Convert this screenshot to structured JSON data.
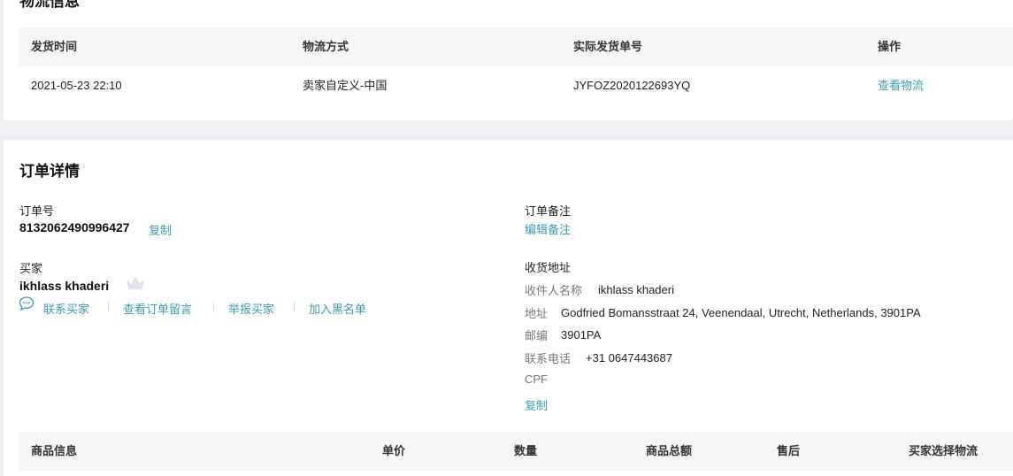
{
  "logistics": {
    "title": "物流信息",
    "headers": [
      "发货时间",
      "物流方式",
      "实际发货单号",
      "操作"
    ],
    "row": {
      "ship_time": "2021-05-23 22:10",
      "method": "卖家自定义-中国",
      "tracking_no": "JYFOZ2020122693YQ",
      "action": "查看物流"
    }
  },
  "order": {
    "title": "订单详情",
    "order_no_label": "订单号",
    "order_no": "8132062490996427",
    "copy_label": "复制",
    "remark_label": "订单备注",
    "edit_remark": "编辑备注",
    "buyer_label": "买家",
    "buyer_name": "ikhlass khaderi",
    "buyer_actions": [
      "联系买家",
      "查看订单留言",
      "举报买家",
      "加入黑名单"
    ],
    "shipping": {
      "title": "收货地址",
      "recipient_label": "收件人名称",
      "recipient": "ikhlass khaderi",
      "address_label": "地址",
      "address": "Godfried Bomansstraat 24, Veenendaal, Utrecht, Netherlands, 3901PA",
      "zip_label": "邮编",
      "zip": "3901PA",
      "phone_label": "联系电话",
      "phone": "+31 0647443687",
      "cpf_label": "CPF",
      "copy_label": "复制"
    },
    "product_headers": [
      "商品信息",
      "单价",
      "数量",
      "商品总额",
      "售后",
      "买家选择物流"
    ]
  },
  "colors": {
    "link": "#3c9cae",
    "page_bg": "#eef0f3",
    "header_bg": "#f5f6f8"
  },
  "icons": {
    "chat": "chat-icon",
    "crown": "crown-icon"
  }
}
